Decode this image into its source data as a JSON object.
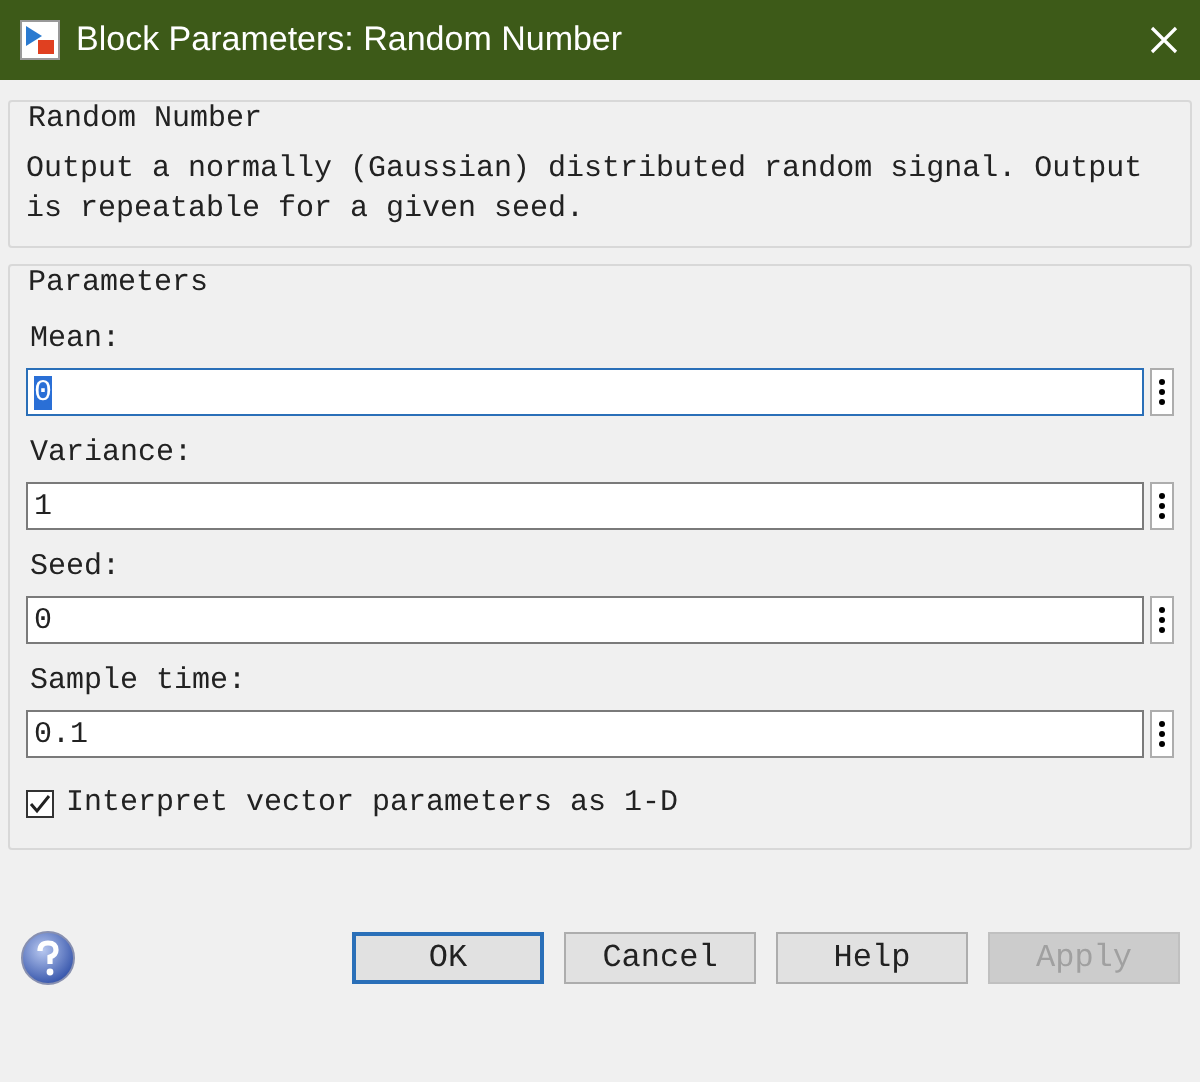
{
  "window": {
    "title": "Block Parameters: Random Number"
  },
  "description": {
    "title": "Random Number",
    "text": "Output a normally (Gaussian) distributed random signal.  Output is repeatable for a given seed."
  },
  "parameters": {
    "title": "Parameters",
    "fields": [
      {
        "label": "Mean:",
        "value": "0",
        "focused": true
      },
      {
        "label": "Variance:",
        "value": "1",
        "focused": false
      },
      {
        "label": "Seed:",
        "value": "0",
        "focused": false
      },
      {
        "label": "Sample time:",
        "value": "0.1",
        "focused": false
      }
    ],
    "checkbox": {
      "label": "Interpret vector parameters as 1-D",
      "checked": true
    }
  },
  "buttons": [
    {
      "label": "OK",
      "default": true,
      "disabled": false
    },
    {
      "label": "Cancel",
      "default": false,
      "disabled": false
    },
    {
      "label": "Help",
      "default": false,
      "disabled": false
    },
    {
      "label": "Apply",
      "default": false,
      "disabled": true
    }
  ]
}
